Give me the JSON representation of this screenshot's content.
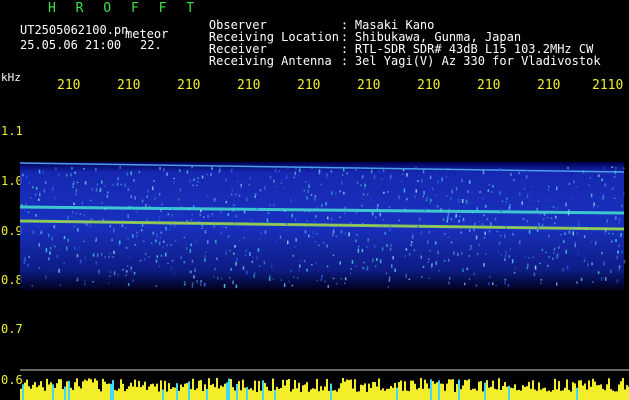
{
  "header": {
    "title": "H R O F F T",
    "filename": "UT2505062100.pn",
    "meteor_label": "meteor",
    "datetime": "25.05.06 21:00",
    "count_label": "22.",
    "rows": [
      {
        "label": "Observer",
        "value": "Masaki Kano"
      },
      {
        "label": "Receiving Location",
        "value": "Shibukawa, Gunma, Japan"
      },
      {
        "label": "Receiver",
        "value": "RTL-SDR SDR# 43dB L15 103.2MHz CW"
      },
      {
        "label": "Receiving Antenna",
        "value": "3el Yagi(V) Az 330 for Vladivostok"
      }
    ]
  },
  "axes": {
    "y_unit": "kHz",
    "x_ticks": [
      "210",
      "210",
      "210",
      "210",
      "210",
      "210",
      "210",
      "210",
      "210",
      "2110"
    ],
    "y_ticks": [
      "1.1",
      "1.0",
      "0.9",
      "0.8",
      "0.7",
      "0.6"
    ]
  },
  "colors": {
    "background": "#000000",
    "tick_text": "#f2ef2a",
    "title_green": "#3fe24a",
    "band_blue": "#1a2fd0",
    "echo_cyan": "#3fd8d0",
    "echo_green": "#7fe05a",
    "noise_bar_yellow": "#f2ef2a"
  }
}
